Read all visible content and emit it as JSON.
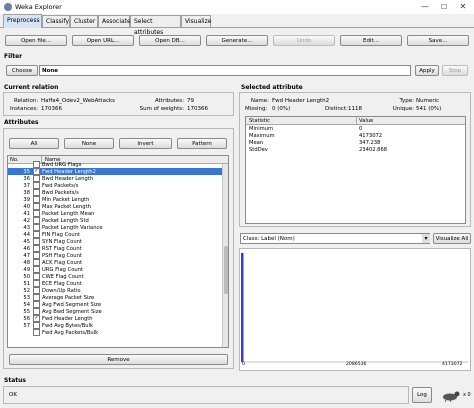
{
  "window": {
    "title": "Weka Explorer",
    "minimize": "—",
    "maximize": "☐",
    "close": "✕"
  },
  "tabs": [
    "Preprocess",
    "Classify",
    "Cluster",
    "Associate",
    "Select attributes",
    "Visualize"
  ],
  "toolbar": {
    "open_file": "Open file...",
    "open_url": "Open URL...",
    "open_db": "Open DB...",
    "generate": "Generate...",
    "undo": "Undo",
    "edit": "Edit...",
    "save": "Save..."
  },
  "filter": {
    "label": "Filter",
    "choose": "Choose",
    "value": "None",
    "apply": "Apply",
    "stop": "Stop"
  },
  "current_relation": {
    "label": "Current relation",
    "relation_label": "Relation:",
    "relation_value": "Haffa4_Odev2_WebAttacks",
    "instances_label": "Instances:",
    "instances_value": "170366",
    "attributes_label": "Attributes:",
    "attributes_value": "79",
    "weights_label": "Sum of weights:",
    "weights_value": "170366"
  },
  "attributes": {
    "label": "Attributes",
    "all": "All",
    "none": "None",
    "invert": "Invert",
    "pattern": "Pattern",
    "col_no": "No.",
    "col_name": "Name",
    "rows": [
      {
        "no": "",
        "name": "Bwd URG Flags",
        "checked": false,
        "selected": false
      },
      {
        "no": "35",
        "name": "Fwd Header Length2",
        "checked": true,
        "selected": true
      },
      {
        "no": "36",
        "name": "Bwd Header Length",
        "checked": false,
        "selected": false
      },
      {
        "no": "37",
        "name": "Fwd Packets/s",
        "checked": false,
        "selected": false
      },
      {
        "no": "38",
        "name": "Bwd Packets/s",
        "checked": false,
        "selected": false
      },
      {
        "no": "39",
        "name": "Min Packet Length",
        "checked": false,
        "selected": false
      },
      {
        "no": "40",
        "name": "Max Packet Length",
        "checked": false,
        "selected": false
      },
      {
        "no": "41",
        "name": "Packet Length Mean",
        "checked": false,
        "selected": false
      },
      {
        "no": "42",
        "name": "Packet Length Std",
        "checked": false,
        "selected": false
      },
      {
        "no": "43",
        "name": "Packet Length Variance",
        "checked": false,
        "selected": false
      },
      {
        "no": "44",
        "name": "FIN Flag Count",
        "checked": false,
        "selected": false
      },
      {
        "no": "45",
        "name": "SYN Flag Count",
        "checked": false,
        "selected": false
      },
      {
        "no": "46",
        "name": "RST Flag Count",
        "checked": false,
        "selected": false
      },
      {
        "no": "47",
        "name": "PSH Flag Count",
        "checked": false,
        "selected": false
      },
      {
        "no": "48",
        "name": "ACK Flag Count",
        "checked": false,
        "selected": false
      },
      {
        "no": "49",
        "name": "URG Flag Count",
        "checked": false,
        "selected": false
      },
      {
        "no": "50",
        "name": "CWE Flag Count",
        "checked": false,
        "selected": false
      },
      {
        "no": "51",
        "name": "ECE Flag Count",
        "checked": false,
        "selected": false
      },
      {
        "no": "52",
        "name": "Down/Up Ratio",
        "checked": false,
        "selected": false
      },
      {
        "no": "53",
        "name": "Average Packet Size",
        "checked": false,
        "selected": false
      },
      {
        "no": "54",
        "name": "Avg Fwd Segment Size",
        "checked": false,
        "selected": false
      },
      {
        "no": "55",
        "name": "Avg Bwd Segment Size",
        "checked": false,
        "selected": false
      },
      {
        "no": "56",
        "name": "Fwd Header Length",
        "checked": true,
        "selected": false
      },
      {
        "no": "57",
        "name": "Fwd Avg Bytes/Bulk",
        "checked": false,
        "selected": false
      },
      {
        "no": "",
        "name": "Fwd Avg Packets/Bulk",
        "checked": false,
        "selected": false
      }
    ],
    "remove": "Remove"
  },
  "selected_attribute": {
    "label": "Selected attribute",
    "name_label": "Name:",
    "name_value": "Fwd Header Length2",
    "type_label": "Type:",
    "type_value": "Numeric",
    "missing_label": "Missing:",
    "missing_value": "0 (0%)",
    "distinct_label": "Distinct:",
    "distinct_value": "1118",
    "unique_label": "Unique:",
    "unique_value": "541 (0%)",
    "col_statistic": "Statistic",
    "col_value": "Value",
    "stats": [
      {
        "name": "Minimum",
        "value": "0"
      },
      {
        "name": "Maximum",
        "value": "4173072"
      },
      {
        "name": "Mean",
        "value": "347.238"
      },
      {
        "name": "StdDev",
        "value": "23402.868"
      }
    ]
  },
  "class_selector": {
    "value": "Class: Label (Nom)",
    "visualize_all": "Visualize All"
  },
  "histogram": {
    "x_min": "0",
    "x_mid": "2086536",
    "x_max": "4173072",
    "bar_color": "#3b3bd6"
  },
  "status": {
    "label": "Status",
    "value": "OK",
    "log": "Log",
    "x_count": "x 0"
  }
}
